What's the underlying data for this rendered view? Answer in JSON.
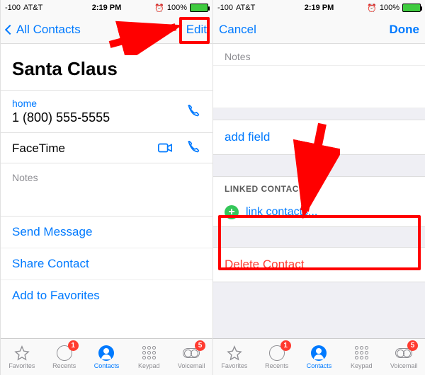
{
  "status": {
    "signal": "-100",
    "carrier": "AT&T",
    "time": "2:19 PM",
    "battery_pct": "100%"
  },
  "left": {
    "nav_back": "All Contacts",
    "nav_edit": "Edit",
    "contact_name": "Santa Claus",
    "phone_label": "home",
    "phone_value": "1 (800) 555-5555",
    "facetime_label": "FaceTime",
    "notes_label": "Notes",
    "actions": {
      "send_message": "Send Message",
      "share_contact": "Share Contact",
      "add_favorites": "Add to Favorites"
    }
  },
  "right": {
    "nav_cancel": "Cancel",
    "nav_done": "Done",
    "notes_label": "Notes",
    "add_field": "add field",
    "linked_header": "LINKED CONTACTS",
    "link_contacts": "link contacts...",
    "delete_contact": "Delete Contact"
  },
  "tabs": {
    "favorites": "Favorites",
    "recents": "Recents",
    "contacts": "Contacts",
    "keypad": "Keypad",
    "voicemail": "Voicemail",
    "recents_badge": "1",
    "voicemail_badge": "5"
  }
}
